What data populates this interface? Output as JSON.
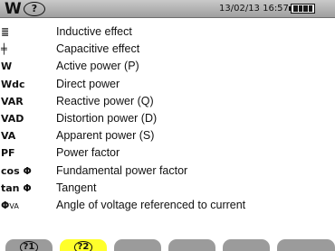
{
  "header": {
    "mode_icon": "W",
    "help_icon": "?",
    "datetime": "13/02/13  16:57"
  },
  "legend": [
    {
      "symbol": "≣",
      "sub": "",
      "label": "Inductive effect"
    },
    {
      "symbol": "╪",
      "sub": "",
      "label": "Capacitive effect"
    },
    {
      "symbol": "W",
      "sub": "",
      "label": "Active power (P)"
    },
    {
      "symbol": "Wdc",
      "sub": "",
      "label": "Direct power"
    },
    {
      "symbol": "VAR",
      "sub": "",
      "label": "Reactive power (Q)"
    },
    {
      "symbol": "VAD",
      "sub": "",
      "label": "Distortion power (D)"
    },
    {
      "symbol": "VA",
      "sub": "",
      "label": "Apparent power (S)"
    },
    {
      "symbol": "PF",
      "sub": "",
      "label": "Power factor"
    },
    {
      "symbol": "cos Φ",
      "sub": "",
      "label": "Fundamental power factor"
    },
    {
      "symbol": "tan Φ",
      "sub": "",
      "label": "Tangent"
    },
    {
      "symbol": "Φ",
      "sub": "VA",
      "label": "Angle of voltage referenced to current"
    }
  ],
  "softkeys": [
    {
      "label": "?1",
      "active": false
    },
    {
      "label": "?2",
      "active": true
    },
    {
      "label": "",
      "active": false
    },
    {
      "label": "",
      "active": false
    },
    {
      "label": "",
      "active": false
    },
    {
      "label": "",
      "active": false
    }
  ],
  "colors": {
    "header_bg": "#b4b4b4",
    "softkey": "#9b9b9b",
    "softkey_active": "#ffff2b"
  }
}
